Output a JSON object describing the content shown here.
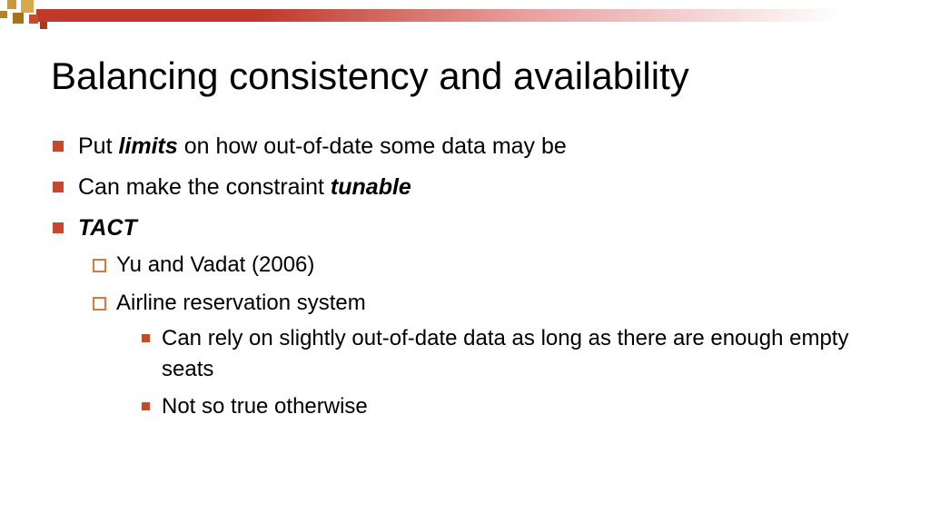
{
  "title": "Balancing consistency and availability",
  "bullets": {
    "b1_pre": "Put ",
    "b1_bold": "limits",
    "b1_post": " on how out-of-date some data may be",
    "b2_pre": "Can make the constraint ",
    "b2_bold": "tunable",
    "b3_bold": "TACT",
    "sub1": "Yu and Vadat (2006)",
    "sub2": "Airline reservation system",
    "subsub1": "Can rely on slightly out-of-date data as long as there are enough empty seats",
    "subsub2": "Not so true otherwise"
  }
}
